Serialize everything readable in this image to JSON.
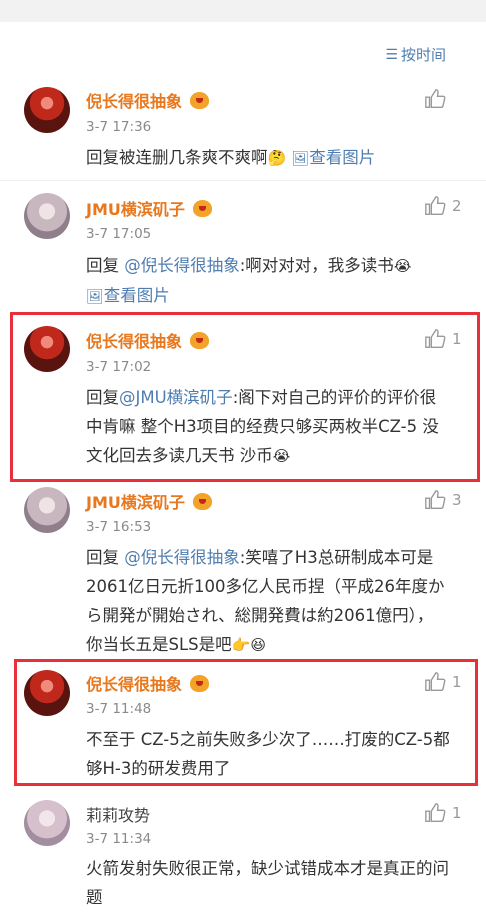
{
  "sort": {
    "icon": "sort-icon",
    "label": "按时间"
  },
  "comments": [
    {
      "author": "倪长得很抽象",
      "time": "3-7 17:36",
      "likes": "",
      "text_plain": "回复被连删几条爽不爽啊",
      "emoji": "🤔",
      "image_link": "查看图片"
    },
    {
      "author": "JMU横滨矶子",
      "time": "3-7 17:05",
      "likes": "2",
      "reply_prefix": "回复 ",
      "mention": "@倪长得很抽象",
      "text": ":啊对对对，我多读书",
      "emoji": "😭",
      "image_link": "查看图片"
    },
    {
      "author": "倪长得很抽象",
      "time": "3-7 17:02",
      "likes": "1",
      "reply_prefix": "回复",
      "mention": "@JMU横滨矶子",
      "text": ":阁下对自己的评价的评价很中肯嘛 整个H3项目的经费只够买两枚半CZ-5 没文化回去多读几天书 沙币",
      "emoji": "😭"
    },
    {
      "author": "JMU横滨矶子",
      "time": "3-7 16:53",
      "likes": "3",
      "reply_prefix": "回复 ",
      "mention": "@倪长得很抽象",
      "text": ":笑嘻了H3总研制成本可是2061亿日元折100多亿人民币捏（平成26年度から開発が開始され、総開発費は約2061億円），你当长五是SLS是吧",
      "emoji": "👉😆"
    },
    {
      "author": "倪长得很抽象",
      "time": "3-7 11:48",
      "likes": "1",
      "text_plain": "不至于 CZ-5之前失败多少次了……打废的CZ-5都够H-3的研发费用了"
    },
    {
      "author": "莉莉攻势",
      "time": "3-7 11:34",
      "likes": "1",
      "text_plain": "火箭发射失败很正常，缺少试错成本才是真正的问题"
    }
  ],
  "colors": {
    "author_vip": "#e8781e",
    "link": "#507daf",
    "highlight_border": "#e8303a"
  }
}
